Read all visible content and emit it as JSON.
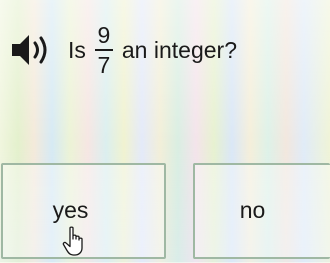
{
  "question": {
    "prefix": "Is",
    "fraction": {
      "numerator": "9",
      "denominator": "7"
    },
    "suffix": "an integer?"
  },
  "answers": [
    {
      "label": "yes"
    },
    {
      "label": "no"
    }
  ],
  "icons": {
    "speaker": "speaker-icon",
    "cursor": "hand-pointer-icon"
  },
  "colors": {
    "text": "#1a1a1a",
    "answer_border": "#9fb8a3"
  }
}
